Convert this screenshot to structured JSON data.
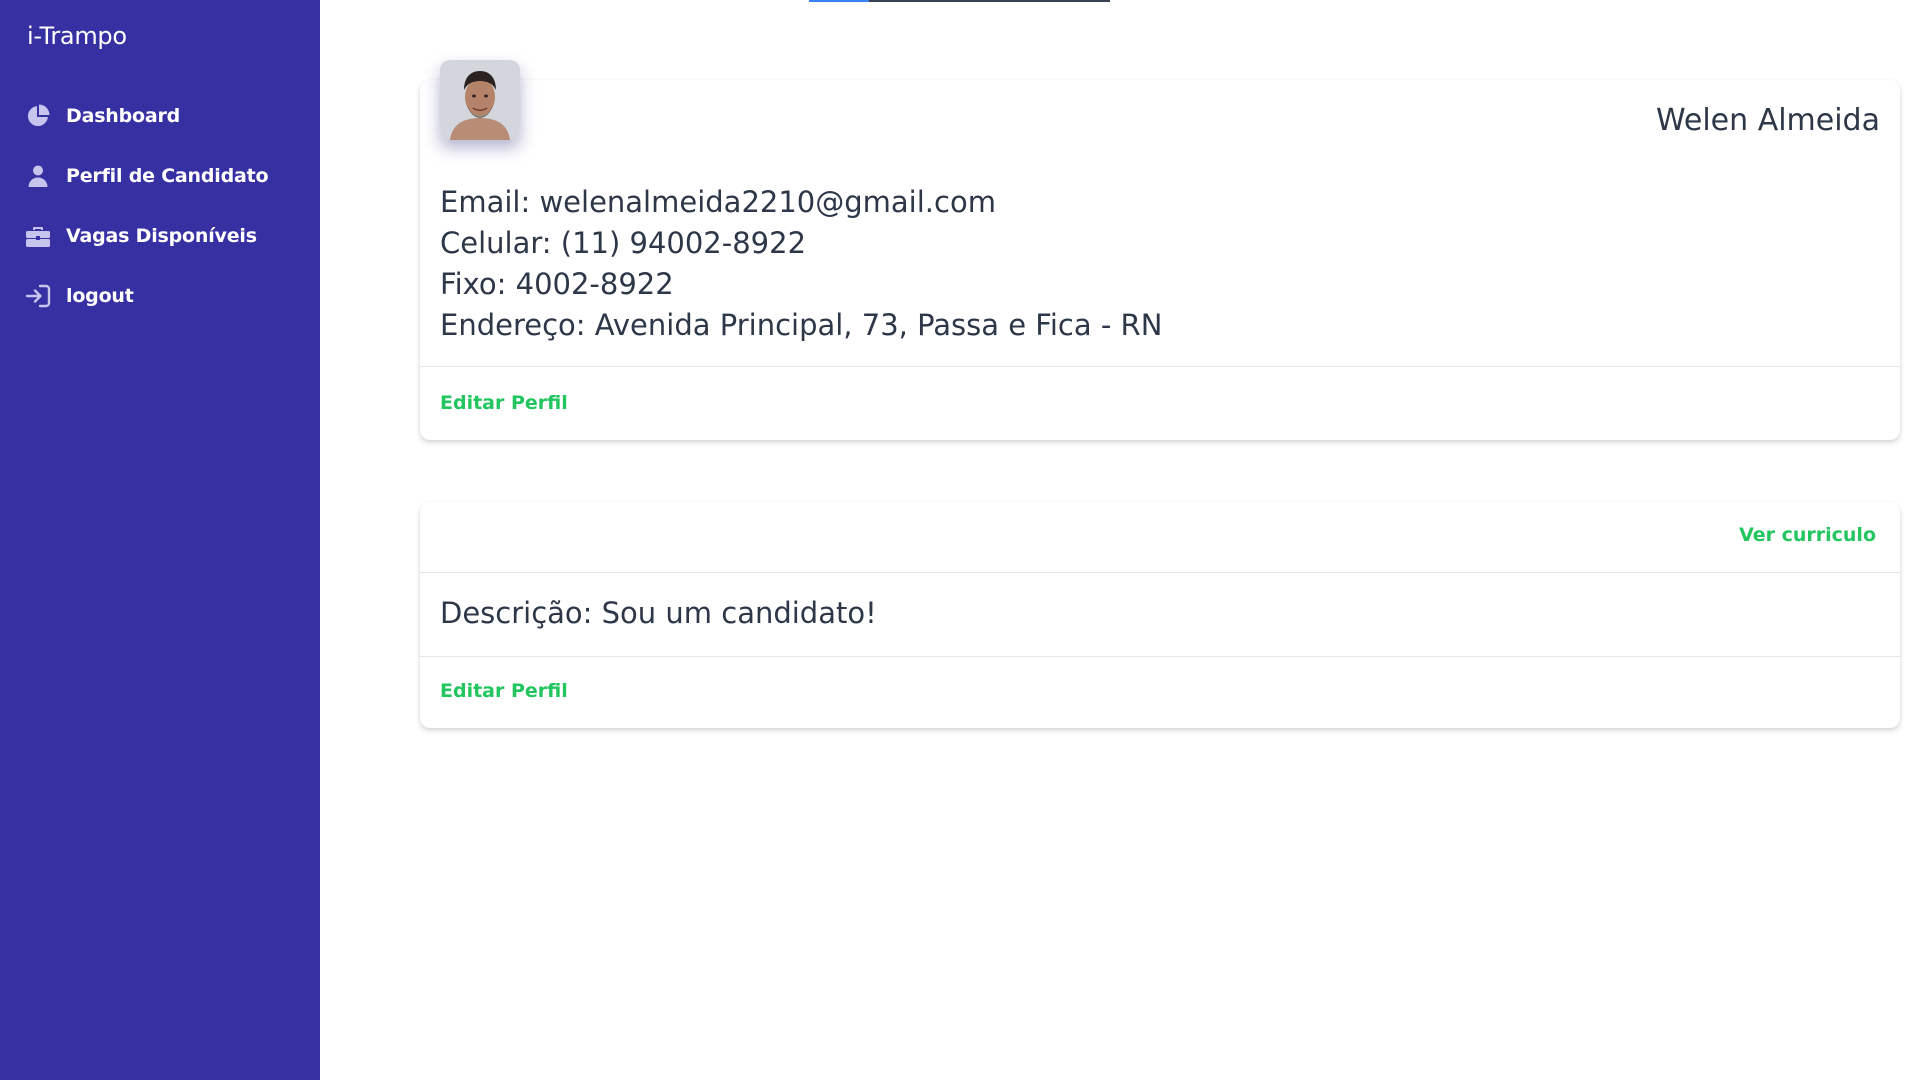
{
  "brand": "i-Trampo",
  "colors": {
    "sidebar_bg": "#3730a3",
    "link_green": "#22c55e",
    "text_dark": "#2d3748"
  },
  "sidebar": {
    "items": [
      {
        "label": "Dashboard",
        "icon": "pie-chart-icon"
      },
      {
        "label": "Perfil de Candidato",
        "icon": "user-icon"
      },
      {
        "label": "Vagas Disponíveis",
        "icon": "briefcase-icon"
      },
      {
        "label": "logout",
        "icon": "sign-in-icon"
      }
    ]
  },
  "profile": {
    "name": "Welen Almeida",
    "email_line": "Email: welenalmeida2210@gmail.com",
    "mobile_line": "Celular: (11) 94002-8922",
    "phone_line": "Fixo: 4002-8922",
    "address_line": "Endereço: Avenida Principal, 73, Passa e Fica - RN",
    "edit_label": "Editar Perfil"
  },
  "resume_card": {
    "resume_link": "Ver curriculo",
    "description_line": "Descrição: Sou um candidato!",
    "edit_label": "Editar Perfil"
  }
}
